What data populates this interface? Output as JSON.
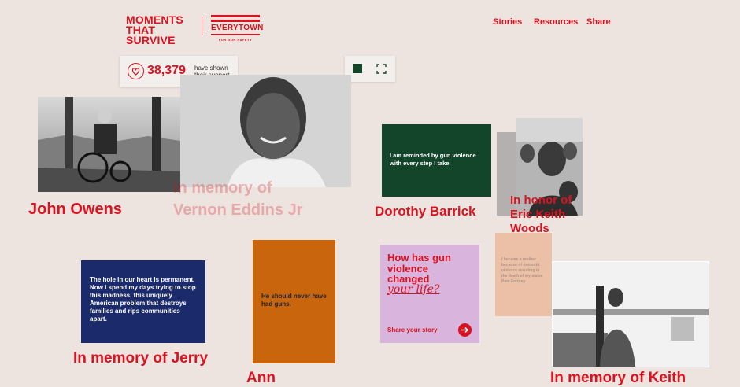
{
  "header": {
    "logo_line1": "MOMENTS",
    "logo_line2": "THAT SURVIVE",
    "partner_name": "EVERYTOWN",
    "partner_sub": "FOR GUN SAFETY",
    "nav": [
      "Stories",
      "Resources",
      "Share"
    ]
  },
  "support": {
    "icon": "heart-icon",
    "count": "38,379",
    "note_line1": "have shown",
    "note_line2": "their support"
  },
  "view_toggle": {
    "icons": [
      "single-view-icon",
      "grid-view-icon"
    ],
    "active_color": "#13452b"
  },
  "stories": {
    "john": {
      "name": "John Owens"
    },
    "vernon": {
      "name_line1": "In memory of",
      "name_line2": "Vernon Eddins Jr"
    },
    "dorothy": {
      "name": "Dorothy Barrick",
      "quote": "I am reminded by gun violence with every step I take."
    },
    "eric": {
      "name_line1": "In honor of",
      "name_line2": "Eric Keith",
      "name_line3": "Woods"
    },
    "jerry": {
      "name": "In memory of Jerry",
      "quote": "The hole in our heart is permanent. Now I spend my days trying to stop this madness, this uniquely American problem that destroys families and rips communities apart."
    },
    "ann": {
      "name": "Ann",
      "quote": "He should never have had guns."
    },
    "mother": {
      "quote": "I became a mother because of domestic violence resulting in the death of my sister. Pam Fortney"
    },
    "keith": {
      "name": "In memory of Keith"
    }
  },
  "cta": {
    "line1": "How has gun",
    "line2": "violence",
    "line3": "changed",
    "line4": "your life?",
    "button": "Share your story",
    "arrow_icon": "arrow-right-icon"
  },
  "colors": {
    "brand_red": "#d9131f",
    "background": "#ede3df",
    "green_card": "#13452b",
    "navy_card": "#1b2a6b",
    "orange_card": "#c9650d",
    "lilac_card": "#d9b4dc",
    "peach_card": "#ebc0a6"
  }
}
